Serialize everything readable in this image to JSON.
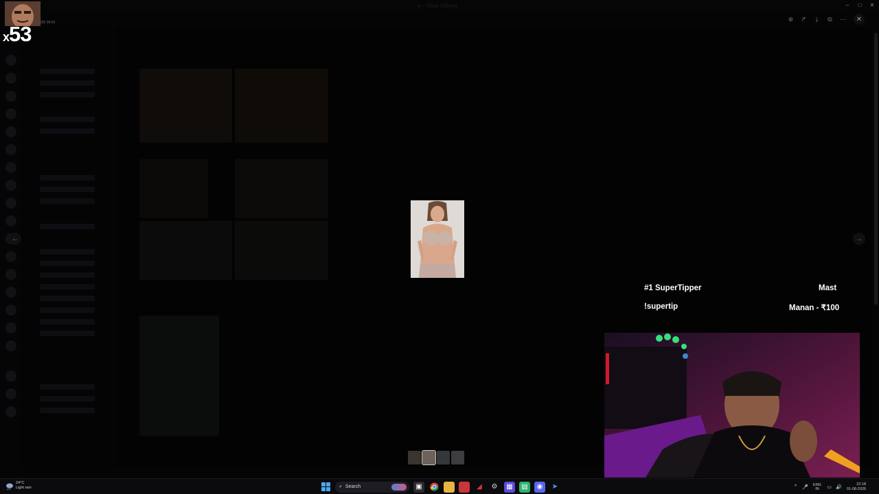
{
  "window": {
    "title": "# – Nina Jatteng",
    "controls": {
      "minimize": "–",
      "maximize": "□",
      "close": "✕"
    }
  },
  "viewer": {
    "toolbar_icons": [
      "zoom-in-icon",
      "share-icon",
      "download-icon",
      "open-external-icon",
      "more-icon"
    ],
    "toolbar_glyphs": [
      "⊕",
      "↱",
      "⤓",
      "⧉",
      "⋯"
    ],
    "close_glyph": "✕",
    "prev_glyph": "←",
    "next_glyph": "→",
    "thumbnail_count": 4,
    "active_thumbnail": 2
  },
  "stream_overlay": {
    "multiplier_prefix": "x",
    "multiplier_value": "53",
    "timestamp": "026 09:60",
    "supertipper_title": "#1 SuperTipper",
    "supertipper_name": "Mast",
    "supertip_command": "!supertip",
    "top_tip": "Manan - ₹100"
  },
  "taskbar": {
    "weather_temp": "24°C",
    "weather_desc": "Light rain",
    "search_label": "Search",
    "language": "ENG",
    "region": "IN",
    "time": "22:18",
    "date": "01-08-2026",
    "tray_glyphs": [
      "^",
      "🎤",
      "⌨",
      "▭",
      "🔊"
    ]
  },
  "colors": {
    "background": "#000000",
    "overlay_text": "#ffffff",
    "taskbar": "#0b0b0e",
    "webcam_accent": "#8a1a7a"
  }
}
